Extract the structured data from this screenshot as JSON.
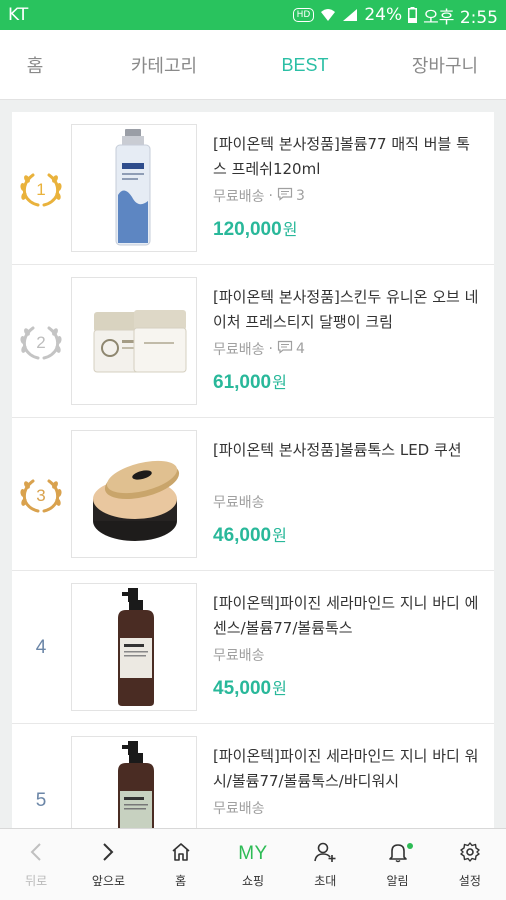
{
  "status_bar": {
    "carrier": "KT",
    "hd": "HD",
    "battery": "24%",
    "time": "오후 2:55"
  },
  "top_nav": {
    "tabs": [
      {
        "label": "홈"
      },
      {
        "label": "카테고리"
      },
      {
        "label": "BEST"
      },
      {
        "label": "장바구니"
      }
    ]
  },
  "products": [
    {
      "rank": "1",
      "title": "[파이온텍 본사정품]볼륨77 매직 버블 톡스 프레쉬120ml",
      "shipping": "무료배송",
      "comments": "3",
      "price": "120,000",
      "currency": "원"
    },
    {
      "rank": "2",
      "title": "[파이온텍 본사정품]스킨두 유니온 오브 네이처 프레스티지 달팽이 크림",
      "shipping": "무료배송",
      "comments": "4",
      "price": "61,000",
      "currency": "원"
    },
    {
      "rank": "3",
      "title": "[파이온텍 본사정품]볼륨톡스 LED 쿠션",
      "shipping": "무료배송",
      "comments": "",
      "price": "46,000",
      "currency": "원"
    },
    {
      "rank": "4",
      "title": "[파이온텍]파이진 세라마인드 지니 바디 에센스/볼륨77/볼륨톡스",
      "shipping": "무료배송",
      "comments": "",
      "price": "45,000",
      "currency": "원"
    },
    {
      "rank": "5",
      "title": "[파이온텍]파이진 세라마인드 지니 바디 워시/볼륨77/볼륨톡스/바디워시",
      "shipping": "무료배송",
      "comments": "",
      "price": "",
      "currency": ""
    }
  ],
  "bottom_bar": {
    "back": "뒤로",
    "forward": "앞으로",
    "home": "홈",
    "my_text": "MY",
    "shopping": "쇼핑",
    "invite": "초대",
    "notifications": "알림",
    "settings": "설정"
  },
  "colors": {
    "status_bar": "#29c35e",
    "accent_teal": "#2bbfa5",
    "price": "#29b89a",
    "gold": "#e9b23c",
    "silver": "#c4c4c4",
    "bronze": "#d9a24e",
    "rank_blue": "#6b86a7"
  }
}
